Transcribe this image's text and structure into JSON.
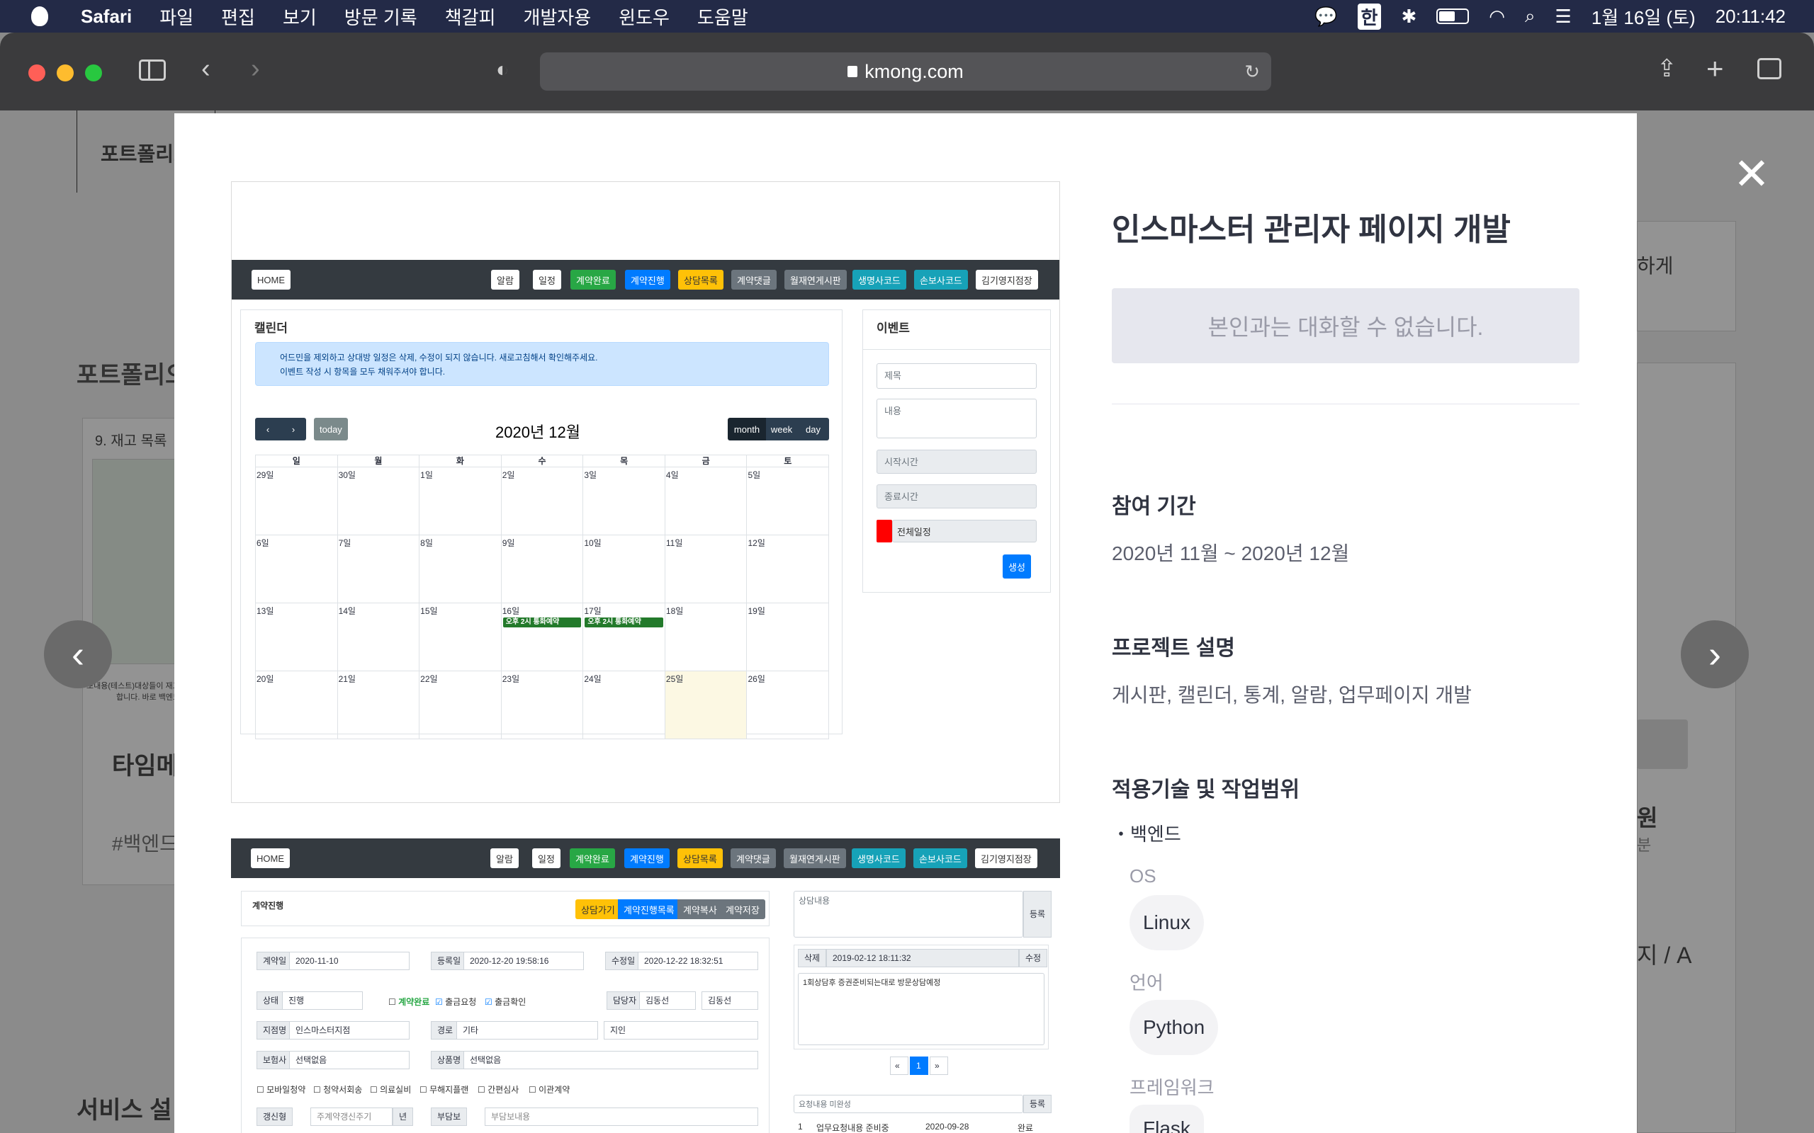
{
  "menubar": {
    "app": "Safari",
    "items": [
      "파일",
      "편집",
      "보기",
      "방문 기록",
      "책갈피",
      "개발자용",
      "윈도우",
      "도움말"
    ],
    "input_method": "한",
    "date": "1월 16일 (토)",
    "time": "20:11:42"
  },
  "browser": {
    "url": "kmong.com"
  },
  "background": {
    "tab": "포트폴리오",
    "section": "포트폴리오",
    "card_caption": "9. 재고 목록",
    "card_title": "타임메",
    "card_tag": "#백엔드",
    "service": "서비스 설",
    "right_text1": "하게",
    "right_text2": "원",
    "right_text3": "분",
    "right_text4": "지 / A",
    "card_note1": "보내용(테스트)대상들이 재고를 확인하는",
    "card_note2": "합니다. 바로 백엔드"
  },
  "project": {
    "title": "인스마스터 관리자 페이지 개발",
    "notice": "본인과는 대화할 수 없습니다.",
    "period_heading": "참여 기간",
    "period": "2020년 11월 ~ 2020년 12월",
    "desc_heading": "프로젝트 설명",
    "desc": "게시판, 캘린더, 통계, 알람, 업무페이지 개발",
    "tech_heading": "적용기술 및 작업범위",
    "scope": "・백엔드",
    "os_label": "OS",
    "os": "Linux",
    "lang_label": "언어",
    "lang": "Python",
    "fw_label": "프레임워크",
    "fw": "Flask"
  },
  "screenshot1": {
    "nav": {
      "home": "HOME",
      "alarm": "알람",
      "schedule": "일정",
      "btn1": "계약완료",
      "btn2": "계약진행",
      "btn3": "상담목록",
      "btn4": "계약댓글",
      "btn5": "월재연게시판",
      "btn6": "생명사코드",
      "btn7": "손보사코드",
      "user": "김기영지점장"
    },
    "cal_title": "캘린더",
    "info1": "어드민을 제외하고 상대방 일정은 삭제, 수정이 되지 않습니다. 새로고침해서 확인해주세요.",
    "info2": "이벤트 작성 시 항목을 모두 채워주셔야 합니다.",
    "today": "today",
    "month_title": "2020년 12월",
    "views": [
      "month",
      "week",
      "day"
    ],
    "dow": [
      "일",
      "월",
      "화",
      "수",
      "목",
      "금",
      "토"
    ],
    "weeks": [
      [
        "29일",
        "30일",
        "1일",
        "2일",
        "3일",
        "4일",
        "5일"
      ],
      [
        "6일",
        "7일",
        "8일",
        "9일",
        "10일",
        "11일",
        "12일"
      ],
      [
        "13일",
        "14일",
        "15일",
        "16일",
        "17일",
        "18일",
        "19일"
      ],
      [
        "20일",
        "21일",
        "22일",
        "23일",
        "24일",
        "25일",
        "26일"
      ]
    ],
    "event_label": "오후 2시 통화예약",
    "event_panel": "이벤트",
    "f_title": "제목",
    "f_content": "내용",
    "f_start": "시작시간",
    "f_end": "종료시간",
    "f_all": "전체일정",
    "create": "생성"
  },
  "screenshot2": {
    "title": "계약진행",
    "tabs": [
      "상담가기",
      "계약진행목록",
      "계약복사",
      "계약저장"
    ],
    "contract_date_l": "계약일",
    "contract_date": "2020-11-10",
    "reg_date_l": "등록일",
    "reg_date": "2020-12-20 19:58:16",
    "mod_date_l": "수정일",
    "mod_date": "2020-12-22 18:32:51",
    "status_l": "상태",
    "status": "진행",
    "c1": "계약완료",
    "c2": "출금요청",
    "c3": "출금확인",
    "manager_l": "담당자",
    "manager1": "김동선",
    "manager2": "김동선",
    "branch_l": "지점명",
    "branch": "인스마스터지점",
    "route_l": "경로",
    "route": "기타",
    "route2": "지인",
    "insurer_l": "보험사",
    "insurer": "선택없음",
    "product_l": "상품명",
    "product": "선택없음",
    "checks": [
      "모바일청약",
      "청약서회송",
      "의료실비",
      "무해지플랜",
      "간편심사",
      "이관계약"
    ],
    "renew_l": "갱신형",
    "renew": "주계약갱신주기",
    "renew_unit": "년",
    "rider_l": "부담보",
    "rider": "부담보내용",
    "consult_ph": "상담내용",
    "reg_btn": "등록",
    "del": "삭제",
    "log_date": "2019-02-12 18:11:32",
    "edit": "수정",
    "log_text": "1회상담후 증권준비되는대로 방문상담예정",
    "page": "1",
    "req_ph": "요청내용 미완성",
    "req_btn": "등록",
    "row_no": "1",
    "row_text": "업무요청내용 준비중",
    "row_date": "2020-09-28",
    "row_status": "완료"
  },
  "colors": {
    "accent": "#007bff",
    "success": "#28a745",
    "warning": "#ffc107",
    "info": "#17a2b8",
    "dark": "#343a40"
  }
}
